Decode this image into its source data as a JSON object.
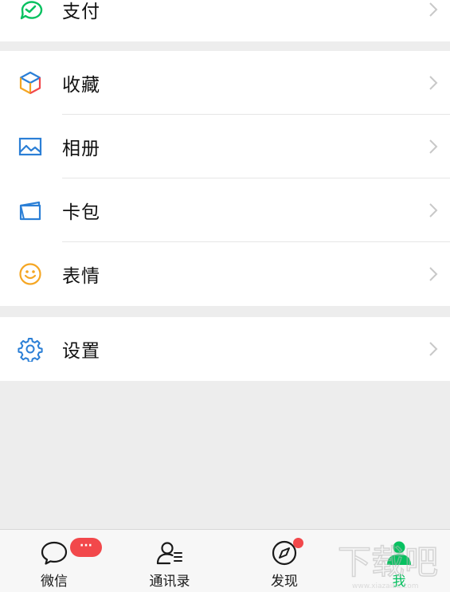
{
  "menu": {
    "pay": {
      "label": "支付",
      "icon": "wallet-check-icon",
      "color": "#07c160"
    },
    "favorites": {
      "label": "收藏",
      "icon": "cube-icon"
    },
    "album": {
      "label": "相册",
      "icon": "photo-album-icon",
      "color": "#2b7fd6"
    },
    "cards": {
      "label": "卡包",
      "icon": "card-wallet-icon",
      "color": "#2b7fd6"
    },
    "stickers": {
      "label": "表情",
      "icon": "smiley-icon",
      "color": "#f5a623"
    },
    "settings": {
      "label": "设置",
      "icon": "gear-icon",
      "color": "#2b7fd6"
    }
  },
  "tabbar": {
    "chats": {
      "label": "微信",
      "badge": "···",
      "icon": "chat-bubble-icon"
    },
    "contacts": {
      "label": "通讯录",
      "icon": "contacts-icon"
    },
    "discover": {
      "label": "发现",
      "icon": "compass-icon",
      "badge_dot": true
    },
    "me": {
      "label": "我",
      "icon": "person-icon",
      "active": true,
      "color": "#07c160"
    }
  },
  "watermark": {
    "text": "下载吧",
    "url_text": "www.xiazaiba.com"
  }
}
